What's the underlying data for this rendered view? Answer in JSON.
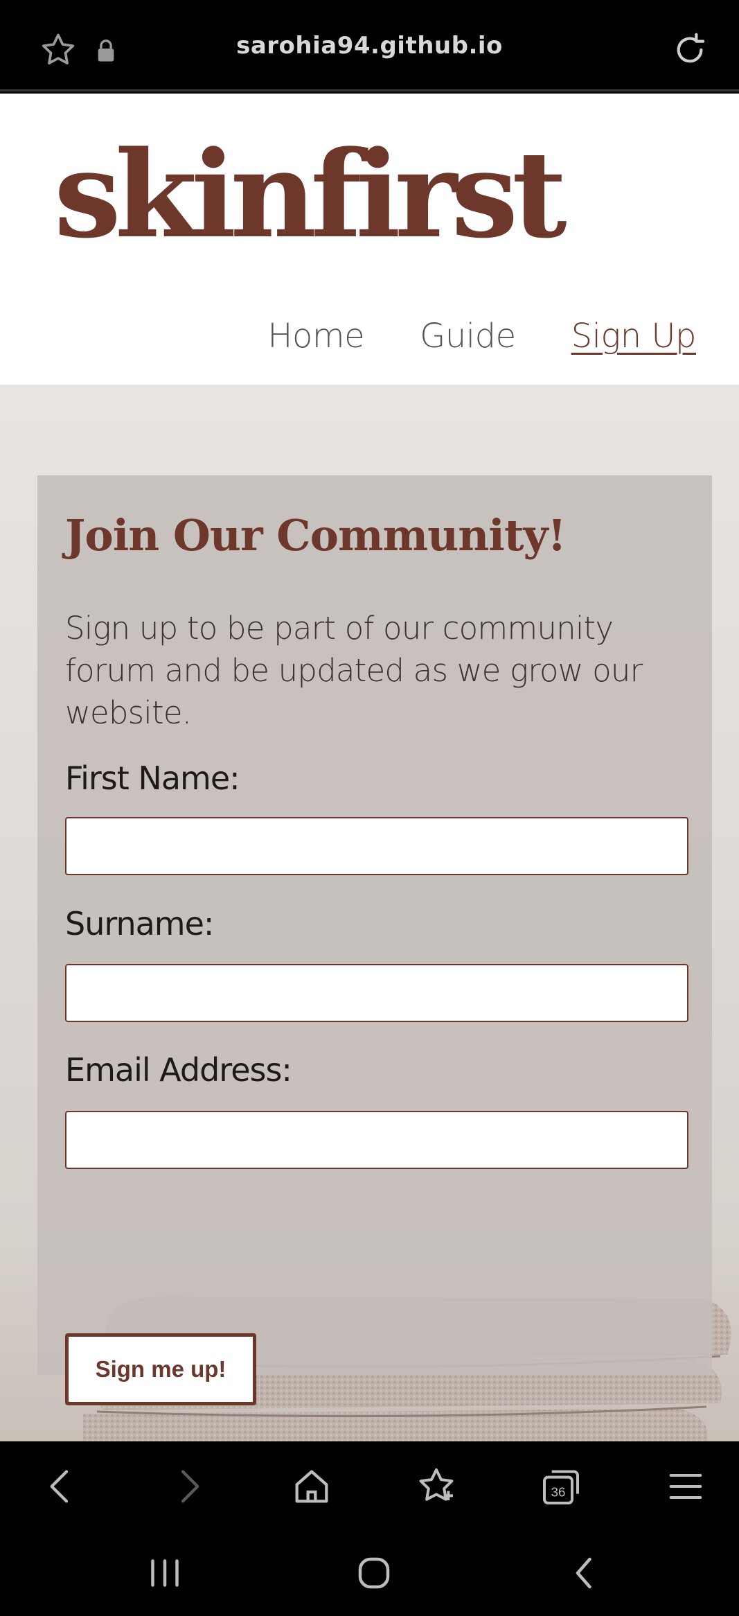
{
  "browser": {
    "url": "sarohia94.github.io",
    "tab_count": "36"
  },
  "site": {
    "logo": "skinfirst",
    "nav": [
      {
        "label": "Home",
        "active": false
      },
      {
        "label": "Guide",
        "active": false
      },
      {
        "label": "Sign Up",
        "active": true
      }
    ]
  },
  "form": {
    "heading": "Join Our Community!",
    "intro": "Sign up to be part of our community forum and be updated as we grow our website.",
    "fields": [
      {
        "label": "First Name:",
        "value": ""
      },
      {
        "label": "Surname:",
        "value": ""
      },
      {
        "label": "Email Address:",
        "value": ""
      }
    ],
    "submit_label": "Sign me up!"
  },
  "colors": {
    "brand": "#6e372b",
    "card_bg": "#c4bdba"
  }
}
